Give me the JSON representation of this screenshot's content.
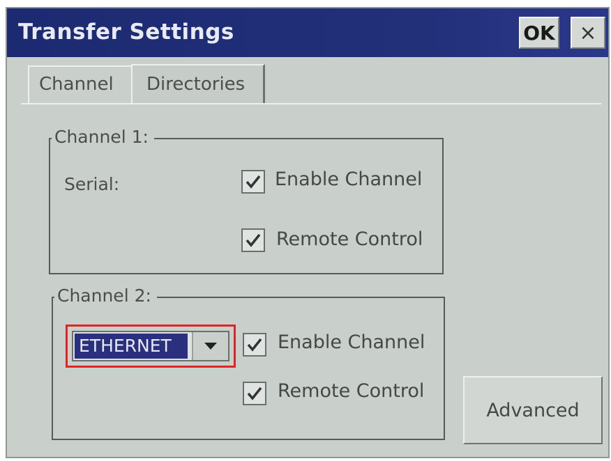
{
  "window": {
    "title": "Transfer Settings",
    "ok_label": "OK",
    "close_glyph": "×"
  },
  "tabs": [
    {
      "label": "Channel",
      "selected": true
    },
    {
      "label": "Directories",
      "selected": false
    }
  ],
  "channel1": {
    "legend": "Channel 1:",
    "type_label": "Serial:",
    "enable_channel": {
      "label": "Enable Channel",
      "checked": true
    },
    "remote_control": {
      "label": "Remote Control",
      "checked": true
    }
  },
  "channel2": {
    "legend": "Channel 2:",
    "type_select": {
      "value": "ETHERNET"
    },
    "enable_channel": {
      "label": "Enable Channel",
      "checked": true
    },
    "remote_control": {
      "label": "Remote Control",
      "checked": true
    }
  },
  "advanced_label": "Advanced",
  "colors": {
    "titlebar": "#1c2a72",
    "highlight_border": "#e02525",
    "selection": "#2a2f7e"
  },
  "icons": {
    "close": "close-icon",
    "checkmark": "checkmark-icon",
    "dropdown": "chevron-down-icon"
  }
}
